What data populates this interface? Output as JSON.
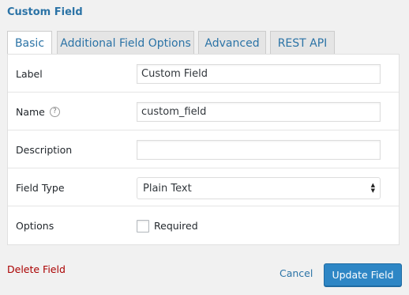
{
  "panel": {
    "title": "Custom Field"
  },
  "tabs": [
    {
      "label": "Basic",
      "active": true
    },
    {
      "label": "Additional Field Options",
      "active": false
    },
    {
      "label": "Advanced",
      "active": false
    },
    {
      "label": "REST API",
      "active": false
    }
  ],
  "form": {
    "label": {
      "label": "Label",
      "value": "Custom Field"
    },
    "name": {
      "label": "Name",
      "value": "custom_field",
      "help_icon": "?"
    },
    "description": {
      "label": "Description",
      "value": ""
    },
    "field_type": {
      "label": "Field Type",
      "selected": "Plain Text"
    },
    "options": {
      "label": "Options",
      "required_label": "Required",
      "required_checked": false
    }
  },
  "actions": {
    "delete_label": "Delete Field",
    "cancel_label": "Cancel",
    "update_label": "Update Field"
  },
  "colors": {
    "accent": "#2b73a6",
    "primary_button": "#2e86c5",
    "danger": "#aa0000"
  }
}
